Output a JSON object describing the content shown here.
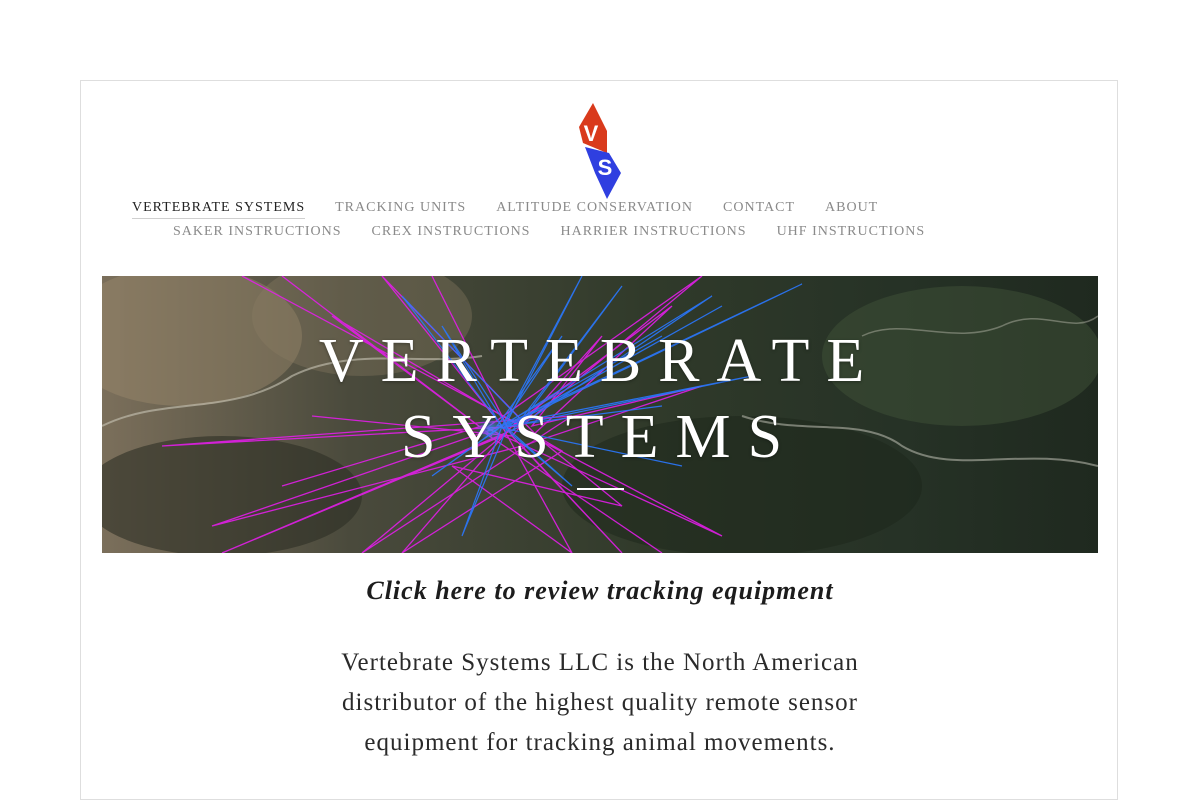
{
  "site": {
    "logo_letters": [
      "V",
      "S"
    ],
    "colors": {
      "logo_red": "#d93a1c",
      "logo_blue": "#2f3fe0",
      "nav_active": "#222222",
      "nav_inactive": "#8a8a8a",
      "track_magenta": "#e21ee8",
      "track_blue": "#2a78ff"
    }
  },
  "nav": {
    "row1": [
      {
        "label": "VERTEBRATE SYSTEMS",
        "active": true
      },
      {
        "label": "TRACKING UNITS"
      },
      {
        "label": "ALTITUDE CONSERVATION"
      },
      {
        "label": "CONTACT"
      },
      {
        "label": "ABOUT"
      }
    ],
    "row2": [
      {
        "label": "SAKER INSTRUCTIONS"
      },
      {
        "label": "CREX INSTRUCTIONS"
      },
      {
        "label": "HARRIER INSTRUCTIONS"
      },
      {
        "label": "UHF INSTRUCTIONS"
      }
    ]
  },
  "hero": {
    "title_line1": "VERTEBRATE",
    "title_line2": "SYSTEMS"
  },
  "cta": {
    "label": "Click here to review tracking equipment"
  },
  "intro": {
    "text": "Vertebrate Systems LLC is the North American distributor of the highest quality remote sensor equipment for tracking animal movements."
  }
}
